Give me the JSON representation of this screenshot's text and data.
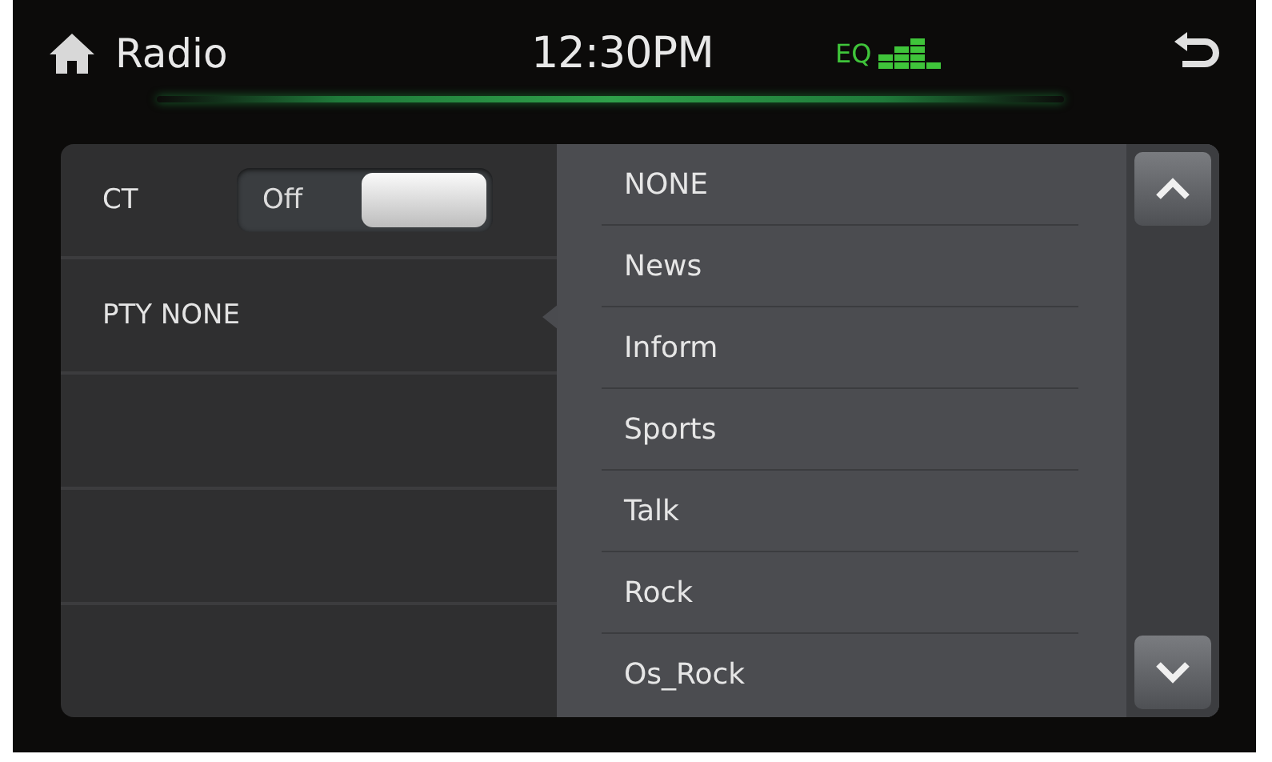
{
  "header": {
    "title": "Radio",
    "time": "12:30PM",
    "eq_label": "EQ"
  },
  "settings": [
    {
      "kind": "toggle",
      "label": "CT",
      "state_text": "Off",
      "on": false
    },
    {
      "kind": "value",
      "label": "PTY NONE",
      "expanded": true
    },
    {
      "kind": "blank"
    },
    {
      "kind": "blank"
    },
    {
      "kind": "blank"
    }
  ],
  "pty_list": [
    "NONE",
    "News",
    "Inform",
    "Sports",
    "Talk",
    "Rock",
    "Os_Rock"
  ]
}
